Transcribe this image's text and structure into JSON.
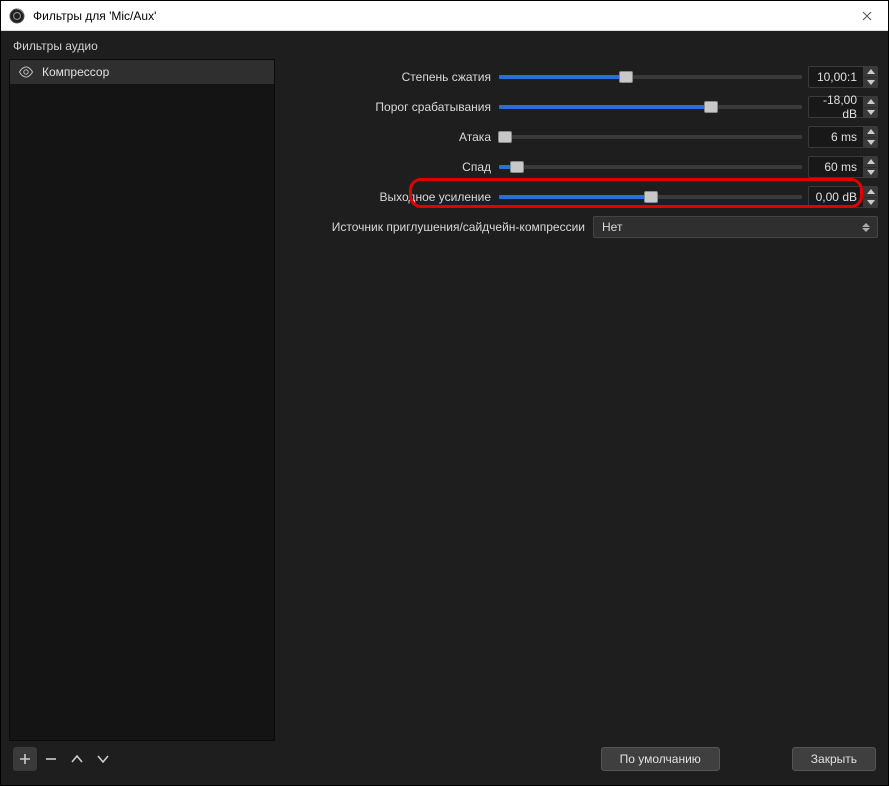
{
  "window": {
    "title": "Фильтры для 'Mic/Aux'"
  },
  "sidebar": {
    "section_label": "Фильтры аудио",
    "items": [
      {
        "label": "Компрессор"
      }
    ]
  },
  "props": {
    "ratio": {
      "label": "Степень сжатия",
      "value": "10,00:1",
      "slider_pct": 42
    },
    "threshold": {
      "label": "Порог срабатывания",
      "value": "-18,00 dB",
      "slider_pct": 70
    },
    "attack": {
      "label": "Атака",
      "value": "6 ms",
      "slider_pct": 2
    },
    "release": {
      "label": "Спад",
      "value": "60 ms",
      "slider_pct": 6
    },
    "gain": {
      "label": "Выходное усиление",
      "value": "0,00 dB",
      "slider_pct": 50
    },
    "sidechain": {
      "label": "Источник приглушения/сайдчейн-компрессии",
      "value": "Нет"
    }
  },
  "footer": {
    "defaults": "По умолчанию",
    "close": "Закрыть"
  }
}
